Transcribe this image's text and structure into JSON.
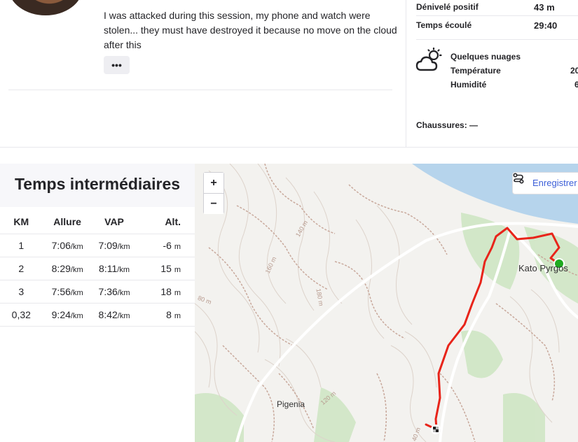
{
  "activity": {
    "description": "I was attacked during this session, my phone and watch were stolen... they must have destroyed it because no move on the cloud after this",
    "more_label": "•••"
  },
  "stats": [
    {
      "label": "Dénivelé positif",
      "value": "43 m"
    },
    {
      "label": "Temps écoulé",
      "value": "29:40"
    }
  ],
  "weather": {
    "condition": "Quelques nuages",
    "temperature_label": "Température",
    "temperature_value": "20",
    "humidity_label": "Humidité",
    "humidity_value": "6",
    "icon": "partly-cloudy-icon"
  },
  "shoes": "Chaussures: —",
  "splits": {
    "title": "Temps intermédiaires",
    "headers": [
      "KM",
      "Allure",
      "VAP",
      "Alt."
    ],
    "rows": [
      {
        "km": "1",
        "allure": "7:06",
        "allure_unit": "/km",
        "vap": "7:09",
        "vap_unit": "/km",
        "alt": "-6",
        "alt_unit": "m"
      },
      {
        "km": "2",
        "allure": "8:29",
        "allure_unit": "/km",
        "vap": "8:11",
        "vap_unit": "/km",
        "alt": "15",
        "alt_unit": "m"
      },
      {
        "km": "3",
        "allure": "7:56",
        "allure_unit": "/km",
        "vap": "7:36",
        "vap_unit": "/km",
        "alt": "18",
        "alt_unit": "m"
      },
      {
        "km": "0,32",
        "allure": "9:24",
        "allure_unit": "/km",
        "vap": "8:42",
        "vap_unit": "/km",
        "alt": "8",
        "alt_unit": "m"
      }
    ]
  },
  "map": {
    "zoom_in": "+",
    "zoom_out": "−",
    "record_label": "Enregistrer",
    "places": [
      "Kato Pyrgos",
      "Pigenia"
    ],
    "contours": [
      "140 m",
      "160 m",
      "180 m",
      "80 m",
      "120 m",
      "40 m"
    ],
    "route_color": "#e8241a",
    "start_color": "#1faa1f"
  }
}
